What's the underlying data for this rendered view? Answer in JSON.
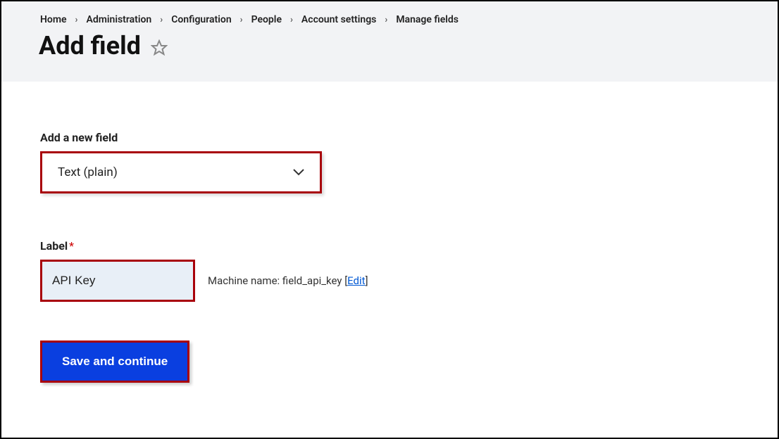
{
  "breadcrumb": {
    "items": [
      {
        "label": "Home"
      },
      {
        "label": "Administration"
      },
      {
        "label": "Configuration"
      },
      {
        "label": "People"
      },
      {
        "label": "Account settings"
      },
      {
        "label": "Manage fields"
      }
    ],
    "separator": "›"
  },
  "page_title": "Add field",
  "form": {
    "field_type_section": {
      "label": "Add a new field",
      "selected_value": "Text (plain)"
    },
    "label_section": {
      "heading": "Label",
      "required_mark": "*",
      "input_value": "API Key",
      "machine_name_prefix": "Machine name: ",
      "machine_name_value": "field_api_key",
      "edit_link_label": "Edit"
    },
    "submit": {
      "button_label": "Save and continue"
    }
  }
}
